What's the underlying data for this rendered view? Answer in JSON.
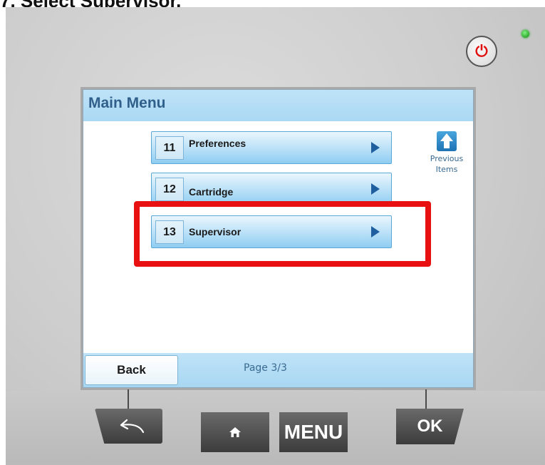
{
  "step_title": "7. Select Supervisor.",
  "screen": {
    "title": "Main Menu",
    "items": [
      {
        "number": "11",
        "label": "Preferences"
      },
      {
        "number": "12",
        "label": "Cartridge"
      },
      {
        "number": "13",
        "label": "Supervisor"
      }
    ],
    "previous_items": {
      "icon": "up-arrow-icon",
      "label_line1": "Previous",
      "label_line2": "Items"
    },
    "back_label": "Back",
    "page_indicator": "Page 3/3"
  },
  "hardware": {
    "menu_label": "MENU",
    "ok_label": "OK",
    "back_icon": "return-arrow-icon",
    "home_icon": "home-icon",
    "power_icon": "power-icon"
  },
  "colors": {
    "highlight": "#e81010",
    "header": "#aad8f3",
    "title_text": "#2f5f8a",
    "led": "#1a9a1a"
  },
  "highlighted_item": "13"
}
